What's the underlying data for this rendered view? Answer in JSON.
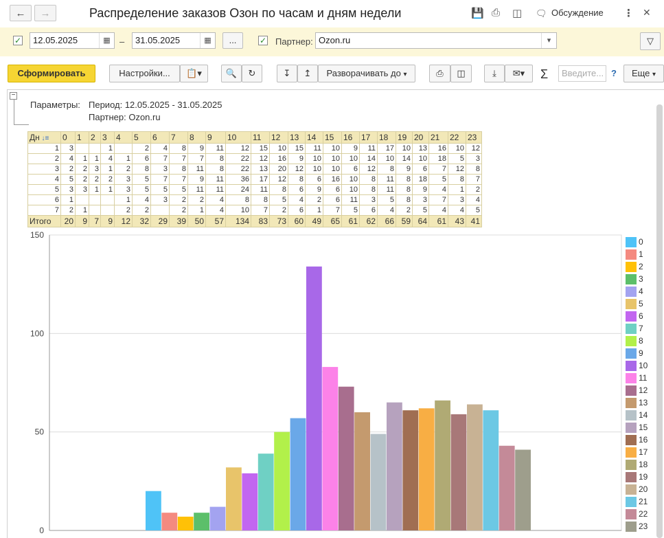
{
  "window": {
    "title": "Распределение заказов Озон по часам и дням недели",
    "discussion_label": "Обсуждение"
  },
  "filters": {
    "date_from": "12.05.2025",
    "date_separator": "–",
    "date_to": "31.05.2025",
    "more_label": "...",
    "partner_label": "Партнер:",
    "partner_value": "Ozon.ru"
  },
  "toolbar": {
    "generate_label": "Сформировать",
    "settings_label": "Настройки...",
    "expand_label": "Разворачивать до",
    "search_placeholder": "Введите...",
    "help_label": "?",
    "more_label": "Еще"
  },
  "params": {
    "label": "Параметры:",
    "period": "Период: 12.05.2025 - 31.05.2025",
    "partner": "Партнер: Ozon.ru"
  },
  "table": {
    "corner_label": "Дн",
    "hours": [
      "0",
      "1",
      "2",
      "3",
      "4",
      "5",
      "6",
      "7",
      "8",
      "9",
      "10",
      "11",
      "12",
      "13",
      "14",
      "15",
      "16",
      "17",
      "18",
      "19",
      "20",
      "21",
      "22",
      "23"
    ],
    "rows": [
      {
        "day": "1",
        "cells": [
          "3",
          "",
          "",
          "1",
          "",
          "2",
          "4",
          "8",
          "9",
          "11",
          "12",
          "15",
          "10",
          "15",
          "11",
          "10",
          "9",
          "11",
          "17",
          "10",
          "13",
          "16",
          "10",
          "12"
        ]
      },
      {
        "day": "2",
        "cells": [
          "4",
          "1",
          "1",
          "4",
          "1",
          "6",
          "7",
          "7",
          "7",
          "8",
          "22",
          "12",
          "16",
          "9",
          "10",
          "10",
          "10",
          "14",
          "10",
          "14",
          "10",
          "18",
          "5",
          "3"
        ]
      },
      {
        "day": "3",
        "cells": [
          "2",
          "2",
          "3",
          "1",
          "2",
          "8",
          "3",
          "8",
          "11",
          "8",
          "22",
          "13",
          "20",
          "12",
          "10",
          "10",
          "6",
          "12",
          "8",
          "9",
          "6",
          "7",
          "12",
          "8"
        ]
      },
      {
        "day": "4",
        "cells": [
          "5",
          "2",
          "2",
          "2",
          "3",
          "5",
          "7",
          "7",
          "9",
          "11",
          "36",
          "17",
          "12",
          "8",
          "6",
          "16",
          "10",
          "8",
          "11",
          "8",
          "18",
          "5",
          "8",
          "7"
        ]
      },
      {
        "day": "5",
        "cells": [
          "3",
          "3",
          "1",
          "1",
          "3",
          "5",
          "5",
          "5",
          "11",
          "11",
          "24",
          "11",
          "8",
          "6",
          "9",
          "6",
          "10",
          "8",
          "11",
          "8",
          "9",
          "4",
          "1",
          "2"
        ]
      },
      {
        "day": "6",
        "cells": [
          "1",
          "",
          "",
          "",
          "1",
          "4",
          "3",
          "2",
          "2",
          "4",
          "8",
          "8",
          "5",
          "4",
          "2",
          "6",
          "11",
          "3",
          "5",
          "8",
          "3",
          "7",
          "3",
          "4"
        ]
      },
      {
        "day": "7",
        "cells": [
          "2",
          "1",
          "",
          "",
          "2",
          "2",
          "",
          "2",
          "1",
          "4",
          "10",
          "7",
          "2",
          "6",
          "1",
          "7",
          "5",
          "6",
          "4",
          "2",
          "5",
          "4",
          "4",
          "5"
        ]
      }
    ],
    "total_label": "Итого",
    "totals": [
      "20",
      "9",
      "7",
      "9",
      "12",
      "32",
      "29",
      "39",
      "50",
      "57",
      "134",
      "83",
      "73",
      "60",
      "49",
      "65",
      "61",
      "62",
      "66",
      "59",
      "64",
      "61",
      "43",
      "41"
    ]
  },
  "chart_data": {
    "type": "bar",
    "title": "",
    "xlabel": "",
    "ylabel": "",
    "ylim": [
      0,
      150
    ],
    "yticks": [
      0,
      50,
      100,
      150
    ],
    "grid": true,
    "legend": "right",
    "series": [
      {
        "name": "0",
        "value": 20,
        "color": "#4fc3f7"
      },
      {
        "name": "1",
        "value": 9,
        "color": "#f48a80"
      },
      {
        "name": "2",
        "value": 7,
        "color": "#ffc107"
      },
      {
        "name": "3",
        "value": 9,
        "color": "#5cbf6a"
      },
      {
        "name": "4",
        "value": 12,
        "color": "#a3a3f0"
      },
      {
        "name": "5",
        "value": 32,
        "color": "#e8c46a"
      },
      {
        "name": "6",
        "value": 29,
        "color": "#c266f0"
      },
      {
        "name": "7",
        "value": 39,
        "color": "#6fd0c4"
      },
      {
        "name": "8",
        "value": 50,
        "color": "#b2f04a"
      },
      {
        "name": "9",
        "value": 57,
        "color": "#6aa8e8"
      },
      {
        "name": "10",
        "value": 134,
        "color": "#a868e8"
      },
      {
        "name": "11",
        "value": 83,
        "color": "#fc82e8"
      },
      {
        "name": "12",
        "value": 73,
        "color": "#a86e8e"
      },
      {
        "name": "13",
        "value": 60,
        "color": "#c49a6e"
      },
      {
        "name": "14",
        "value": 49,
        "color": "#b6c2c8"
      },
      {
        "name": "15",
        "value": 65,
        "color": "#b6a2be"
      },
      {
        "name": "16",
        "value": 61,
        "color": "#a06e52"
      },
      {
        "name": "17",
        "value": 62,
        "color": "#f8ae44"
      },
      {
        "name": "18",
        "value": 66,
        "color": "#b0aa74"
      },
      {
        "name": "19",
        "value": 59,
        "color": "#a87878"
      },
      {
        "name": "20",
        "value": 64,
        "color": "#c8b294"
      },
      {
        "name": "21",
        "value": 61,
        "color": "#6cc8e4"
      },
      {
        "name": "22",
        "value": 43,
        "color": "#c48a98"
      },
      {
        "name": "23",
        "value": 41,
        "color": "#9e9e8c"
      }
    ]
  }
}
